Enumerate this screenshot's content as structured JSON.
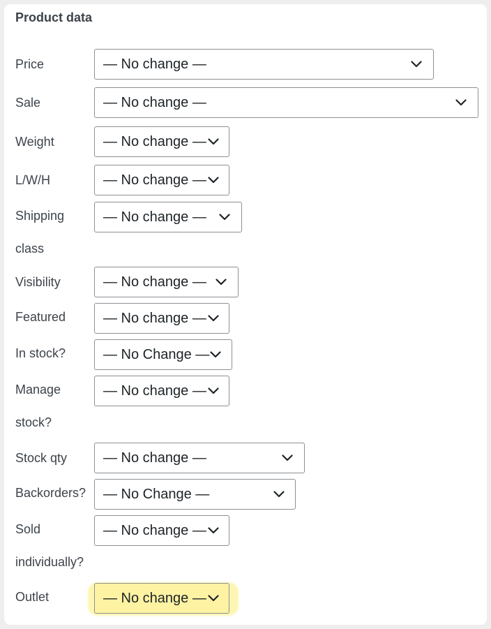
{
  "panel": {
    "title": "Product data"
  },
  "fields": [
    {
      "id": "price",
      "label": "Price",
      "value": "— No change —"
    },
    {
      "id": "sale",
      "label": "Sale",
      "value": "— No change —"
    },
    {
      "id": "weight",
      "label": "Weight",
      "value": "— No change —"
    },
    {
      "id": "lwh",
      "label": "L/W/H",
      "value": "— No change —"
    },
    {
      "id": "shipping-class",
      "label_line1": "Shipping",
      "label_line2": "class",
      "value": "— No change —"
    },
    {
      "id": "visibility",
      "label": "Visibility",
      "value": "— No change —"
    },
    {
      "id": "featured",
      "label": "Featured",
      "value": "— No change —"
    },
    {
      "id": "in-stock",
      "label": "In stock?",
      "value": "— No Change —"
    },
    {
      "id": "manage-stock",
      "label_line1": "Manage",
      "label_line2": "stock?",
      "value": "— No change —"
    },
    {
      "id": "stock-qty",
      "label": "Stock qty",
      "value": "— No change —"
    },
    {
      "id": "backorders",
      "label": "Backorders?",
      "value": "— No Change —"
    },
    {
      "id": "sold-individually",
      "label_line1": "Sold",
      "label_line2": "individually?",
      "value": "— No change —"
    },
    {
      "id": "outlet",
      "label": "Outlet",
      "value": "— No change —"
    }
  ],
  "colors": {
    "highlight": "#fef3a3",
    "label_text": "#3c434a",
    "border": "#8c8f94"
  },
  "icons": {
    "dropdown": "chevron-down-icon"
  }
}
